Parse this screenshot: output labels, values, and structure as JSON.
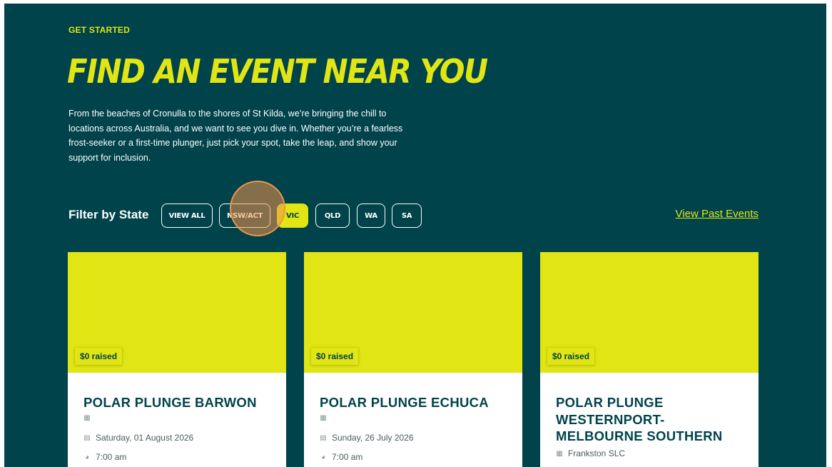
{
  "hero": {
    "eyebrow": "GET STARTED",
    "title": "FIND AN EVENT NEAR YOU",
    "intro": "From the beaches of Cronulla to the shores of St Kilda, we’re bringing the chill to locations across Australia, and we want to see you dive in. Whether you’re a fearless frost-seeker or a first-time plunger, just pick your spot, take the leap, and show your support for inclusion."
  },
  "filter": {
    "label": "Filter by State",
    "chips": [
      "VIEW ALL",
      "NSW/ACT",
      "VIC",
      "QLD",
      "WA",
      "SA"
    ],
    "active": "VIC",
    "past_link": "View Past Events"
  },
  "events": [
    {
      "raised": "$0 raised",
      "title": "POLAR PLUNGE BARWON",
      "location": "",
      "date": "Saturday, 01 August 2026",
      "time": "7:00 am"
    },
    {
      "raised": "$0 raised",
      "title": "POLAR PLUNGE ECHUCA",
      "location": "",
      "date": "Sunday, 26 July 2026",
      "time": "7:00 am"
    },
    {
      "raised": "$0 raised",
      "title": "POLAR PLUNGE WESTERNPORT-MELBOURNE SOUTHERN",
      "location": "Frankston SLC"
    }
  ],
  "icons": {
    "location": "map-icon",
    "date": "calendar-icon",
    "time": "clock-icon"
  },
  "colors": {
    "background": "#00434b",
    "accent": "#e0e513",
    "cursor": "#f0944a"
  }
}
